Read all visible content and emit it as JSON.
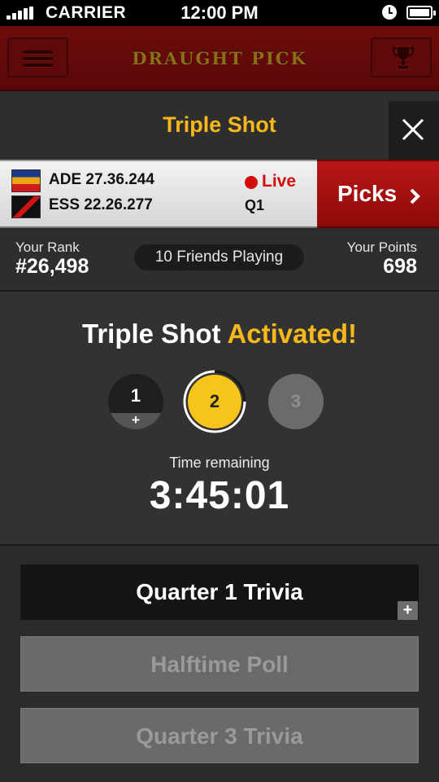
{
  "status_bar": {
    "carrier": "CARRIER",
    "time": "12:00 PM",
    "icons": [
      "signal-icon",
      "alarm-icon",
      "battery-icon"
    ]
  },
  "nav": {
    "logo": "DRAUGHT PICK",
    "menu_icon": "hamburger-menu-icon",
    "trophy_icon": "trophy-icon"
  },
  "header": {
    "title": "Triple Shot",
    "close_icon": "close-icon"
  },
  "match": {
    "teams": [
      {
        "abbr": "ADE",
        "score": "ADE 27.36.244"
      },
      {
        "abbr": "ESS",
        "score": "ESS 22.26.277"
      }
    ],
    "live": "Live",
    "quarter": "Q1",
    "picks_label": "Picks"
  },
  "rank": {
    "rank_label": "Your Rank",
    "rank_value": "#26,498",
    "friends": "10 Friends Playing",
    "points_label": "Your Points",
    "points_value": "698"
  },
  "activation": {
    "heading_prefix": "Triple Shot",
    "heading_accent": "Activated!",
    "shots": [
      {
        "number": "1",
        "badge": "+",
        "state": "used"
      },
      {
        "number": "2",
        "state": "active"
      },
      {
        "number": "3",
        "state": "locked"
      }
    ],
    "time_label": "Time remaining",
    "time_value": "3:45:01"
  },
  "trivia": [
    {
      "label": "Quarter 1 Trivia",
      "state": "enabled"
    },
    {
      "label": "Halftime Poll",
      "state": "disabled"
    },
    {
      "label": "Quarter 3 Trivia",
      "state": "disabled"
    }
  ],
  "trivia_expand": "+",
  "colors": {
    "accent": "#f7b81c",
    "brand_red": "#8e0a0a",
    "live_red": "#d40e0e"
  }
}
